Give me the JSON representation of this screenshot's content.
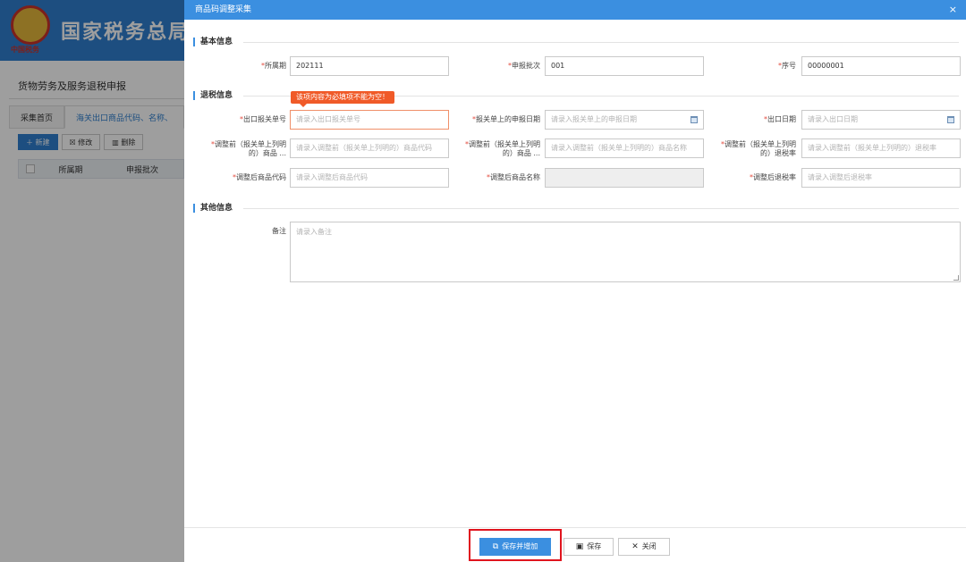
{
  "background": {
    "site_title": "国家税务总局",
    "emblem_caption": "中国税务",
    "section_title": "货物劳务及服务退税申报",
    "tabs": [
      "采集首页",
      "海关出口商品代码、名称、"
    ],
    "toolbar": {
      "new": "新建",
      "edit": "修改",
      "delete": "删除"
    },
    "table_headers": [
      "所属期",
      "申报批次"
    ]
  },
  "dialog": {
    "title": "商品码调整采集",
    "close_glyph": "×",
    "sections": {
      "basic": "基本信息",
      "refund": "退税信息",
      "other": "其他信息"
    },
    "basic": {
      "period_label": "所属期",
      "period_value": "202111",
      "batch_label": "申报批次",
      "batch_value": "001",
      "seq_label": "序号",
      "seq_value": "00000001"
    },
    "refund": {
      "error_tip": "该项内容为必填项不能为空！",
      "customs_no_label": "出口报关单号",
      "customs_no_placeholder": "请录入出口报关单号",
      "declare_date_label": "报关单上的申报日期",
      "declare_date_placeholder": "请录入报关单上的申报日期",
      "export_date_label": "出口日期",
      "export_date_placeholder": "请录入出口日期",
      "pre_code_label_1": "调整前（报关单上列明",
      "pre_code_label_2": "的）商品 ...",
      "pre_code_placeholder": "请录入调整前（报关单上列明的）商品代码",
      "pre_name_label_1": "调整前（报关单上列明",
      "pre_name_label_2": "的）商品 ...",
      "pre_name_placeholder": "请录入调整前（报关单上列明的）商品名称",
      "pre_rate_label_1": "调整前（报关单上列明",
      "pre_rate_label_2": "的）退税率",
      "pre_rate_placeholder": "请录入调整前（报关单上列明的）退税率",
      "post_code_label": "调整后商品代码",
      "post_code_placeholder": "请录入调整后商品代码",
      "post_name_label": "调整后商品名称",
      "post_rate_label": "调整后退税率",
      "post_rate_placeholder": "请录入调整后退税率"
    },
    "other": {
      "remark_label": "备注",
      "remark_placeholder": "请录入备注"
    },
    "buttons": {
      "save_add": "保存并增加",
      "save": "保存",
      "close": "关闭"
    },
    "required_mark": "*"
  },
  "colors": {
    "primary": "#3b8fe0",
    "error": "#f05a28",
    "highlight": "#e0141e",
    "required": "#e34b3e"
  }
}
